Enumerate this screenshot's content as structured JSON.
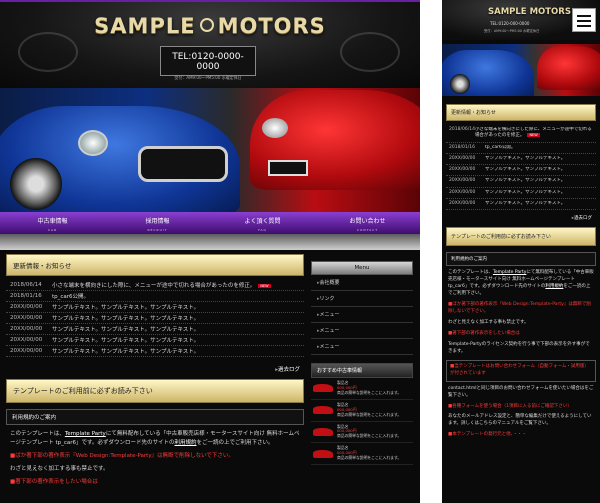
{
  "brand": {
    "logo_left": "SAMPLE",
    "logo_right": "MOTORS",
    "tel": "TEL:0120-0000-0000",
    "hours": "受付：AM9:00〜PM5:00 水曜定休日",
    "colors": {
      "accent_purple": "#6b1fa3",
      "gold": "#e8d9a8",
      "red_text": "#ff3a3a"
    }
  },
  "nav": [
    {
      "label": "中古車情報",
      "en": "CAR"
    },
    {
      "label": "採用情報",
      "en": "RECRUIT"
    },
    {
      "label": "よく頂く質問",
      "en": "FAQ"
    },
    {
      "label": "お問い合わせ",
      "en": "CONTACT"
    }
  ],
  "news": {
    "heading": "更新情報・お知らせ",
    "new_badge": "NEW",
    "items": [
      {
        "date": "2018/06/14",
        "text": "小さな端末を横向きにした際に、メニューが途中で切れる場合があったのを修正。",
        "is_new": true
      },
      {
        "date": "2018/01/16",
        "text": "tp_car6公開。",
        "is_new": false
      },
      {
        "date": "20XX/00/00",
        "text": "サンプルテキスト。サンプルテキスト。サンプルテキスト。",
        "is_new": false
      },
      {
        "date": "20XX/00/00",
        "text": "サンプルテキスト。サンプルテキスト。サンプルテキスト。",
        "is_new": false
      },
      {
        "date": "20XX/00/00",
        "text": "サンプルテキスト。サンプルテキスト。サンプルテキスト。",
        "is_new": false
      },
      {
        "date": "20XX/00/00",
        "text": "サンプルテキスト。サンプルテキスト。サンプルテキスト。",
        "is_new": false
      },
      {
        "date": "20XX/00/00",
        "text": "サンプルテキスト。サンプルテキスト。サンプルテキスト。",
        "is_new": false
      }
    ],
    "past_link": "過去ログ"
  },
  "template_notice": {
    "heading": "テンプレートのご利用前に必ずお読み下さい",
    "sub_heading": "利用規約のご案内",
    "body_pre": "このテンプレートは、",
    "body_link": "Template Party",
    "body_post": "にて無料配布している「中古車販売店様・モータースサイト向け 無料ホームページテンプレート tp_car6」です。必ずダウンロード先のサイトの",
    "body_link2": "利用規約",
    "body_end": "をご一読の上でご利用下さい。",
    "red1": "■ばか著下部の著作表示『Web Design:Template-Party』は無断で削除しないで下さい。",
    "note": "わざと見えなく加工する事も禁止です。",
    "red2": "■著下部の著作表示をしたい場合は",
    "red2_more": "Template-Partyのライセンス契約を行う事で下部の表示を外す事ができます。",
    "red3": "■当テンプレートはお問い合わせフォーム（自動フォーム・試用版）が付されています",
    "mob_extra1": "contact.htmlと同じ項目のお問い合わせフォームを使いたい場合はをご覧下さい。",
    "mob_extra2": "■各種フォームを使う場合（1項目に入る前にご確認下さい）",
    "mob_extra3": "あなたのメールアドレス設定と、簡単な編集だけで使えるようにしています。詳しくはこちらのマニュアルをご覧下さい。",
    "mob_extra4": "■本テンプレートの発行元と他、・・・"
  },
  "sidebar": {
    "menu_title": "Menu",
    "menu_items": [
      "会社概要",
      "リンク",
      "メニュー",
      "メニュー",
      "メニュー"
    ],
    "cars_title": "おすすめ中古車情報",
    "cars": [
      {
        "name": "製品名",
        "price": "000,000円",
        "desc": "商品の簡単な説明をここに入れます。"
      },
      {
        "name": "製品名",
        "price": "000,000円",
        "desc": "商品の簡単な説明をここに入れます。"
      },
      {
        "name": "製品名",
        "price": "000,000円",
        "desc": "商品の簡単な説明をここに入れます。"
      },
      {
        "name": "製品名",
        "price": "000,000円",
        "desc": "商品の簡単な説明をここに入れます。"
      }
    ]
  },
  "mobile": {
    "logo": "SAMPLE MOTORS",
    "tel": "TEL:0120-000-0000",
    "hours": "受付：AM9:00〜PM5:00 水曜定休日",
    "news_items": [
      {
        "date": "2018/06/14",
        "text": "小さな端末を横向きにした際に、メニューが途中で切れる場合があったのを修正。",
        "is_new": true
      },
      {
        "date": "2018/01/16",
        "text": "tp_car6公開。"
      },
      {
        "date": "20XX/00/00",
        "text": "サンプルテキスト。サンプルテキスト。"
      },
      {
        "date": "20XX/00/00",
        "text": "サンプルテキスト。サンプルテキスト。"
      },
      {
        "date": "20XX/00/00",
        "text": "サンプルテキスト。サンプルテキスト。"
      },
      {
        "date": "20XX/00/00",
        "text": "サンプルテキスト。サンプルテキスト。"
      },
      {
        "date": "20XX/00/00",
        "text": "サンプルテキスト。サンプルテキスト。"
      }
    ]
  }
}
